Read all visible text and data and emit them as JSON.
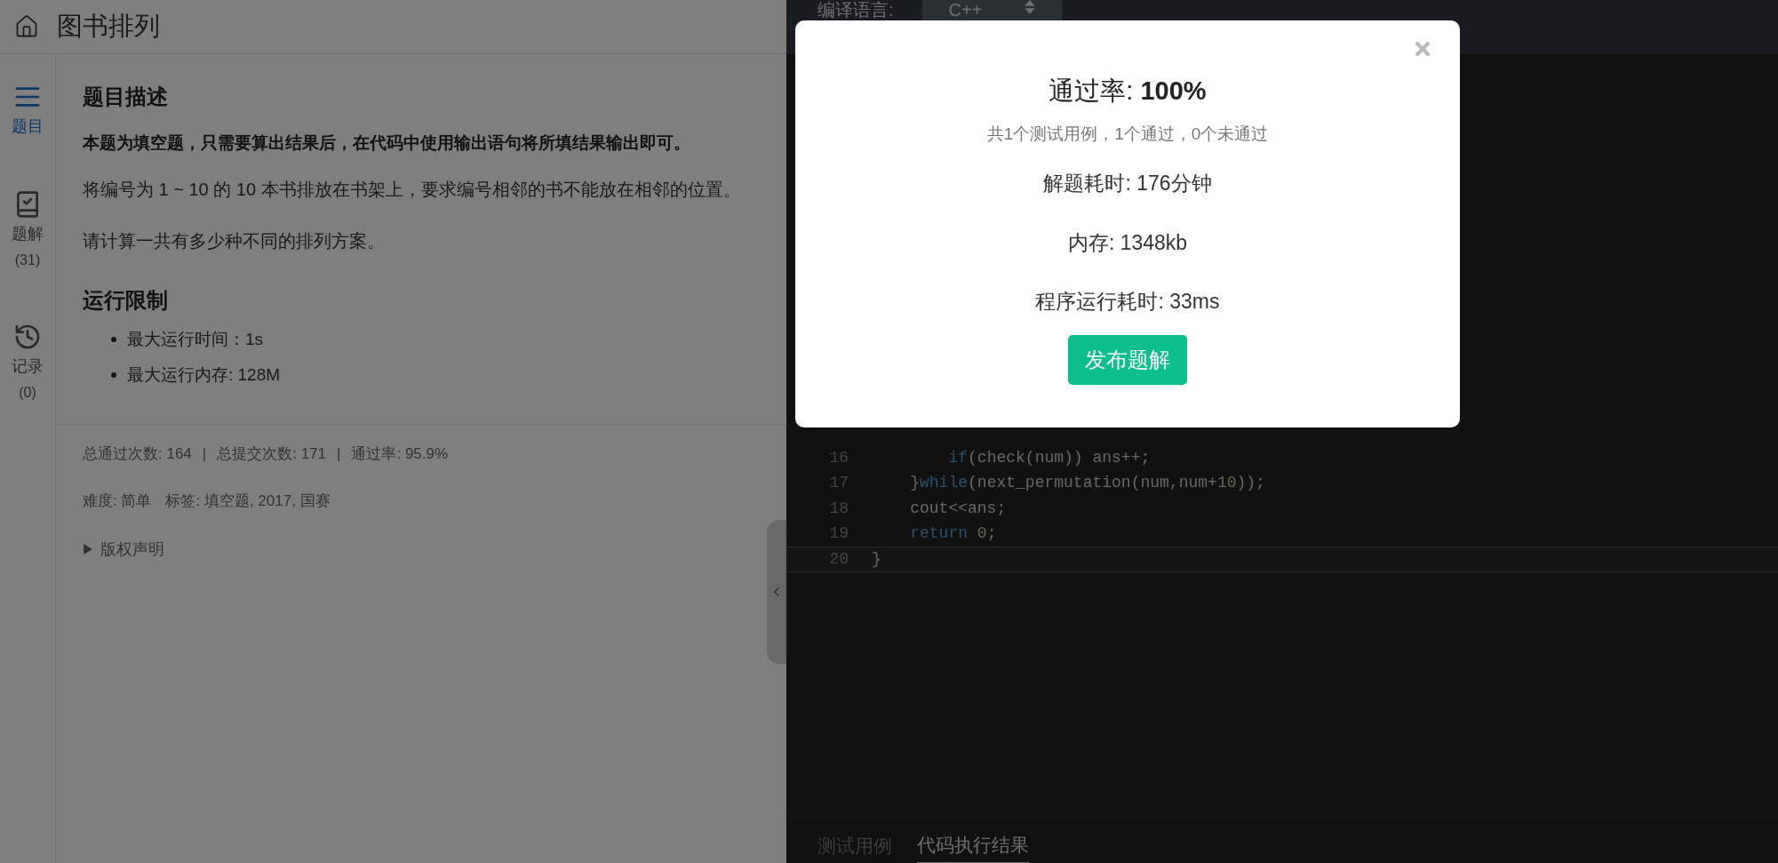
{
  "header": {
    "title": "图书排列"
  },
  "sidebar": {
    "items": [
      {
        "kind": "list",
        "label": "题目",
        "selected": true
      },
      {
        "kind": "solution",
        "label": "题解",
        "count": "(31)",
        "selected": false
      },
      {
        "kind": "history",
        "label": "记录",
        "count": "(0)",
        "selected": false
      }
    ]
  },
  "description": {
    "heading": "题目描述",
    "notice": "本题为填空题，只需要算出结果后，在代码中使用输出语句将所填结果输出即可。",
    "paragraphs": [
      "将编号为 1 ~ 10 的 10 本书排放在书架上，要求编号相邻的书不能放在相邻的位置。",
      "请计算一共有多少种不同的排列方案。"
    ]
  },
  "limits": {
    "heading": "运行限制",
    "items": [
      "最大运行时间：1s",
      "最大运行内存: 128M"
    ]
  },
  "stats": [
    "总通过次数: 164",
    "|",
    "总提交次数: 171",
    "|",
    "通过率: 95.9%"
  ],
  "meta": [
    "难度: 简单",
    "标签: 填空题, 2017, 国赛"
  ],
  "copyright": {
    "label": "版权声明",
    "expanded": false
  },
  "editor": {
    "language_label": "编译语言:",
    "language": "C++",
    "lines": [
      {
        "number": "16",
        "current": false,
        "tokens": [
          {
            "kind": "keyword",
            "text": "        if"
          },
          {
            "kind": "plain",
            "text": "(check(num)) ans++;"
          }
        ]
      },
      {
        "number": "17",
        "current": false,
        "tokens": [
          {
            "kind": "plain",
            "text": "    }"
          },
          {
            "kind": "keyword",
            "text": "while"
          },
          {
            "kind": "plain",
            "text": "(next_permutation(num,num+"
          },
          {
            "kind": "number",
            "text": "10"
          },
          {
            "kind": "plain",
            "text": "));"
          }
        ]
      },
      {
        "number": "18",
        "current": false,
        "tokens": [
          {
            "kind": "plain",
            "text": "    cout<<ans;"
          }
        ]
      },
      {
        "number": "19",
        "current": false,
        "tokens": [
          {
            "kind": "keyword",
            "text": "    return"
          },
          {
            "kind": "number",
            "text": " 0"
          },
          {
            "kind": "plain",
            "text": ";"
          }
        ]
      },
      {
        "number": "20",
        "current": true,
        "tokens": [
          {
            "kind": "plain",
            "text": "}"
          }
        ]
      }
    ],
    "tabs": [
      {
        "label": "测试用例",
        "selected": false
      },
      {
        "label": "代码执行结果",
        "selected": true
      }
    ]
  },
  "modal": {
    "title": "通过率: **100%**",
    "summary": "共1个测试用例，1个通过，0个未通过",
    "lines": [
      "解题耗时: 176分钟",
      "内存: 1348kb",
      "程序运行耗时: 33ms"
    ],
    "button": "发布题解"
  }
}
